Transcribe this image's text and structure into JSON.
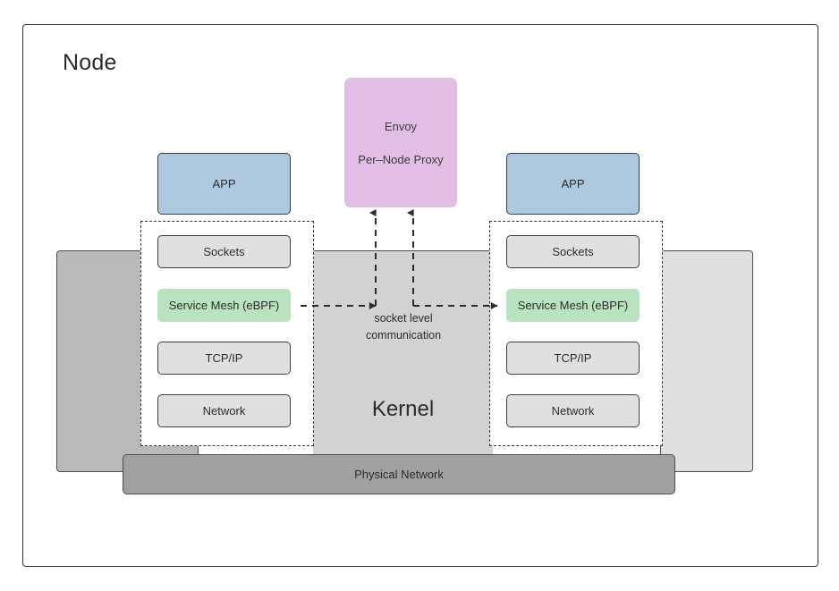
{
  "diagram": {
    "title": "Node",
    "kernel_label": "Kernel",
    "physical_network_label": "Physical Network",
    "communication_label_line1": "socket level",
    "communication_label_line2": "communication"
  },
  "envoy": {
    "line1": "Envoy",
    "line2": "Per–Node Proxy"
  },
  "left_stack": {
    "app": "APP",
    "layers": [
      {
        "label": "Sockets"
      },
      {
        "label": "Service Mesh (eBPF)"
      },
      {
        "label": "TCP/IP"
      },
      {
        "label": "Network"
      }
    ]
  },
  "right_stack": {
    "app": "APP",
    "layers": [
      {
        "label": "Sockets"
      },
      {
        "label": "Service Mesh (eBPF)"
      },
      {
        "label": "TCP/IP"
      },
      {
        "label": "Network"
      }
    ]
  },
  "colors": {
    "app": "#aec8df",
    "envoy": "#e2bee7",
    "service_mesh": "#b9e3bf",
    "layer": "#e0e0e0",
    "kernel": "#d2d2d2",
    "physical_network": "#a0a0a0",
    "left_panel": "#b9b9b9",
    "right_panel": "#e0e0e0",
    "stroke": "#3d3d3d"
  }
}
